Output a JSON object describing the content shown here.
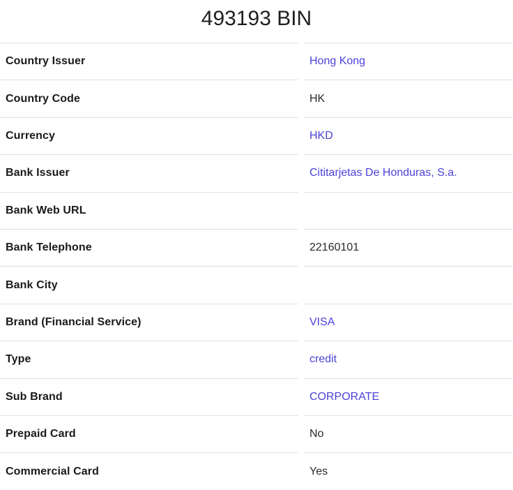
{
  "page": {
    "title": "493193 BIN"
  },
  "colors": {
    "link": "#4b42d8",
    "text": "#2b2b2b",
    "label": "#1a1a1a",
    "border": "#dee2e6",
    "background": "#ffffff"
  },
  "table": {
    "rows": [
      {
        "label": "Country Issuer",
        "value": "Hong Kong",
        "is_link": true
      },
      {
        "label": "Country Code",
        "value": "HK",
        "is_link": false
      },
      {
        "label": "Currency",
        "value": "HKD",
        "is_link": true
      },
      {
        "label": "Bank Issuer",
        "value": "Cititarjetas De Honduras, S.a.",
        "is_link": true
      },
      {
        "label": "Bank Web URL",
        "value": "",
        "is_link": false
      },
      {
        "label": "Bank Telephone",
        "value": "22160101",
        "is_link": false
      },
      {
        "label": "Bank City",
        "value": "",
        "is_link": false
      },
      {
        "label": "Brand (Financial Service)",
        "value": "VISA",
        "is_link": true
      },
      {
        "label": "Type",
        "value": "credit",
        "is_link": true
      },
      {
        "label": "Sub Brand",
        "value": "CORPORATE",
        "is_link": true
      },
      {
        "label": "Prepaid Card",
        "value": "No",
        "is_link": false
      },
      {
        "label": "Commercial Card",
        "value": "Yes",
        "is_link": false
      }
    ]
  }
}
